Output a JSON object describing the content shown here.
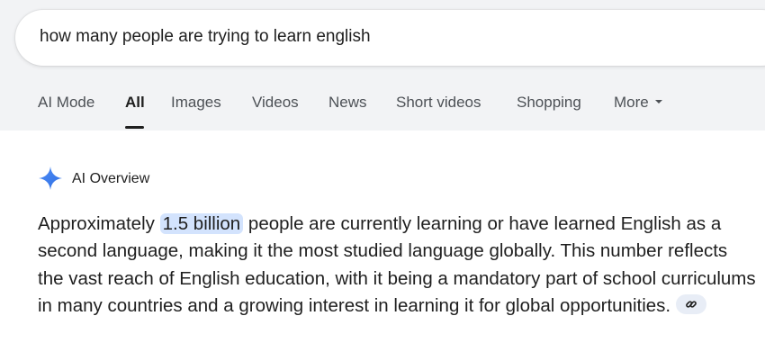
{
  "search": {
    "query": "how many people are trying to learn english"
  },
  "tabs": [
    {
      "label": "AI Mode"
    },
    {
      "label": "All"
    },
    {
      "label": "Images"
    },
    {
      "label": "Videos"
    },
    {
      "label": "News"
    },
    {
      "label": "Short videos"
    },
    {
      "label": "Shopping"
    },
    {
      "label": "More"
    }
  ],
  "active_tab": "All",
  "ai_overview": {
    "label": "AI Overview",
    "answer_prefix": "Approximately",
    "answer_highlight": "1.5 billion",
    "answer_rest": "people are currently learning or have learned English as a second language, making it the most studied language globally. This number reflects the vast reach of English education, with it being a mandatory part of school curriculums in many countries and a growing interest in learning it for global opportunities."
  },
  "icons": {
    "spark": "ai-spark-icon",
    "link": "link-icon",
    "caret": "chevron-down-icon"
  },
  "colors": {
    "accent_blue": "#4285f4",
    "highlight": "#d3e3fd",
    "band": "#f2f3f5",
    "text": "#1f1f1f"
  }
}
